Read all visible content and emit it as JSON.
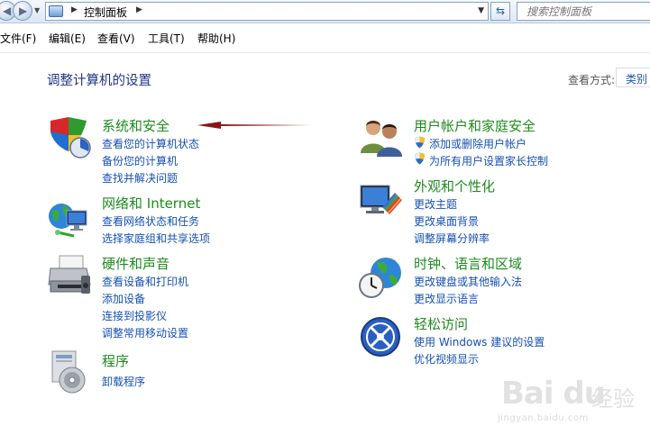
{
  "address_bar": {
    "path": "控制面板",
    "search_placeholder": "搜索控制面板"
  },
  "menu": [
    {
      "label": "文件(F)"
    },
    {
      "label": "编辑(E)"
    },
    {
      "label": "查看(V)"
    },
    {
      "label": "工具(T)"
    },
    {
      "label": "帮助(H)"
    }
  ],
  "header": {
    "title": "调整计算机的设置",
    "view_by_label": "查看方式:",
    "view_by_value": "类别"
  },
  "categories": {
    "system_security": {
      "icon": "system-security-shield-icon",
      "title": "系统和安全",
      "links": [
        "查看您的计算机状态",
        "备份您的计算机",
        "查找并解决问题"
      ]
    },
    "network": {
      "icon": "network-globe-icon",
      "title": "网络和 Internet",
      "links": [
        "查看网络状态和任务",
        "选择家庭组和共享选项"
      ]
    },
    "hardware": {
      "icon": "hardware-printer-icon",
      "title": "硬件和声音",
      "links": [
        "查看设备和打印机",
        "添加设备",
        "连接到投影仪",
        "调整常用移动设置"
      ]
    },
    "programs": {
      "icon": "programs-disc-icon",
      "title": "程序",
      "links": [
        "卸载程序"
      ]
    },
    "user_accounts": {
      "icon": "user-accounts-icon",
      "title": "用户帐户和家庭安全",
      "links": [
        "添加或删除用户帐户",
        "为所有用户设置家长控制"
      ]
    },
    "appearance": {
      "icon": "appearance-display-icon",
      "title": "外观和个性化",
      "links": [
        "更改主题",
        "更改桌面背景",
        "调整屏幕分辨率"
      ]
    },
    "clock": {
      "icon": "clock-globe-icon",
      "title": "时钟、语言和区域",
      "links": [
        "更改键盘或其他输入法",
        "更改显示语言"
      ]
    },
    "ease": {
      "icon": "ease-of-access-icon",
      "title": "轻松访问",
      "links": [
        "使用 Windows 建议的设置",
        "优化视频显示"
      ]
    }
  },
  "annotation": {
    "color": "#8b1414"
  },
  "watermark": {
    "logo": "Bai du",
    "text": "经验",
    "url": "jingyan.baidu.com"
  }
}
